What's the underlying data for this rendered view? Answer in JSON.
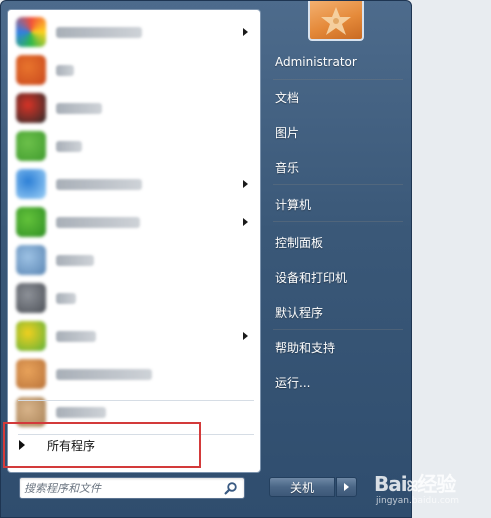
{
  "start_menu": {
    "programs": [
      {
        "icon": "colorful-flower-app-icon",
        "colors": [
          "#f24e3a",
          "#ffd21f",
          "#2eb84b",
          "#2f7fe6"
        ],
        "label_width": 86,
        "has_submenu": true
      },
      {
        "icon": "orange-avatar-app-icon",
        "colors": [
          "#e8742c",
          "#c9481e"
        ],
        "label_width": 18,
        "has_submenu": false
      },
      {
        "icon": "red-bird-app-icon",
        "colors": [
          "#d83326",
          "#2b2b2b"
        ],
        "label_width": 46,
        "has_submenu": false
      },
      {
        "icon": "green-blocks-app-icon",
        "colors": [
          "#6cc04a",
          "#3f9b2e"
        ],
        "label_width": 26,
        "has_submenu": false
      },
      {
        "icon": "blue-swirl-app-icon",
        "colors": [
          "#2c7fd6",
          "#9ed1f7"
        ],
        "label_width": 86,
        "has_submenu": true
      },
      {
        "icon": "green-circle-app-icon",
        "colors": [
          "#63c23a",
          "#2f8f24"
        ],
        "label_width": 84,
        "has_submenu": true
      },
      {
        "icon": "calculator-app-icon",
        "colors": [
          "#9cc1e4",
          "#5b86b3"
        ],
        "label_width": 38,
        "has_submenu": false
      },
      {
        "icon": "gray-gear-app-icon",
        "colors": [
          "#8d9198",
          "#4d5158"
        ],
        "label_width": 20,
        "has_submenu": false
      },
      {
        "icon": "yellow-green-app-icon",
        "colors": [
          "#f1d01f",
          "#5db13a"
        ],
        "label_width": 40,
        "has_submenu": true
      },
      {
        "icon": "orange-folder-app-icon",
        "colors": [
          "#e8a25a",
          "#b9733a"
        ],
        "label_width": 96,
        "has_submenu": false
      },
      {
        "icon": "tan-folder-app-icon",
        "colors": [
          "#d8b48a",
          "#a98257"
        ],
        "label_width": 50,
        "has_submenu": false
      }
    ],
    "all_programs_label": "所有程序",
    "search_placeholder": "搜索程序和文件",
    "right_items": [
      {
        "label": "Administrator"
      },
      {
        "label": "文档"
      },
      {
        "label": "图片"
      },
      {
        "label": "音乐"
      },
      {
        "label": "计算机"
      },
      {
        "label": "控制面板"
      },
      {
        "label": "设备和打印机"
      },
      {
        "label": "默认程序"
      },
      {
        "label": "帮助和支持"
      },
      {
        "label": "运行..."
      }
    ],
    "shutdown_label": "关机"
  }
}
